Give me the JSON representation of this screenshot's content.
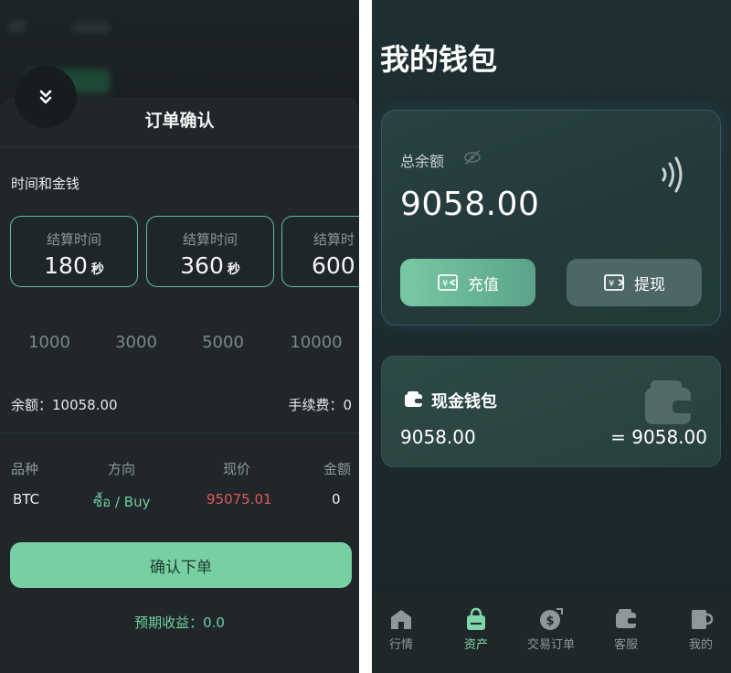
{
  "order_sheet": {
    "title": "订单确认",
    "section_label": "时间和金钱",
    "time_cards": [
      {
        "label": "结算时间",
        "value": "180",
        "unit": "秒"
      },
      {
        "label": "结算时间",
        "value": "360",
        "unit": "秒"
      },
      {
        "label": "结算时",
        "value": "600",
        "unit": ""
      }
    ],
    "amounts": [
      "1000",
      "3000",
      "5000",
      "10000"
    ],
    "balance": "余额：10058.00",
    "fee": "手续费：0",
    "table": {
      "headers": [
        "品种",
        "方向",
        "现价",
        "金额"
      ],
      "row": {
        "symbol": "BTC",
        "direction": "ซื้อ / Buy",
        "price": "95075.01",
        "amount": "0"
      }
    },
    "confirm_label": "确认下单",
    "expected_profit": "预期收益：0.0",
    "colors": {
      "accent": "#76d0a2",
      "price": "#e05a5a",
      "buy": "#6fcf9f"
    }
  },
  "wallet": {
    "title": "我的钱包",
    "balance_label": "总余额",
    "balance_value": "9058.00",
    "recharge_label": "充值",
    "withdraw_label": "提现",
    "cash_wallet": {
      "title": "现金钱包",
      "amount": "9058.00",
      "equivalent": "= 9058.00"
    },
    "icons": [
      "eye-off-icon",
      "nfc-icon",
      "recharge-icon",
      "withdraw-icon",
      "wallet-icon"
    ]
  },
  "tabbar": {
    "items": [
      {
        "label": "行情",
        "icon": "home-icon",
        "active": false
      },
      {
        "label": "资产",
        "icon": "bag-icon",
        "active": true
      },
      {
        "label": "交易订单",
        "icon": "coin-icon",
        "active": false
      },
      {
        "label": "客服",
        "icon": "wallet-icon",
        "active": false
      },
      {
        "label": "我的",
        "icon": "mug-icon",
        "active": false
      }
    ]
  }
}
